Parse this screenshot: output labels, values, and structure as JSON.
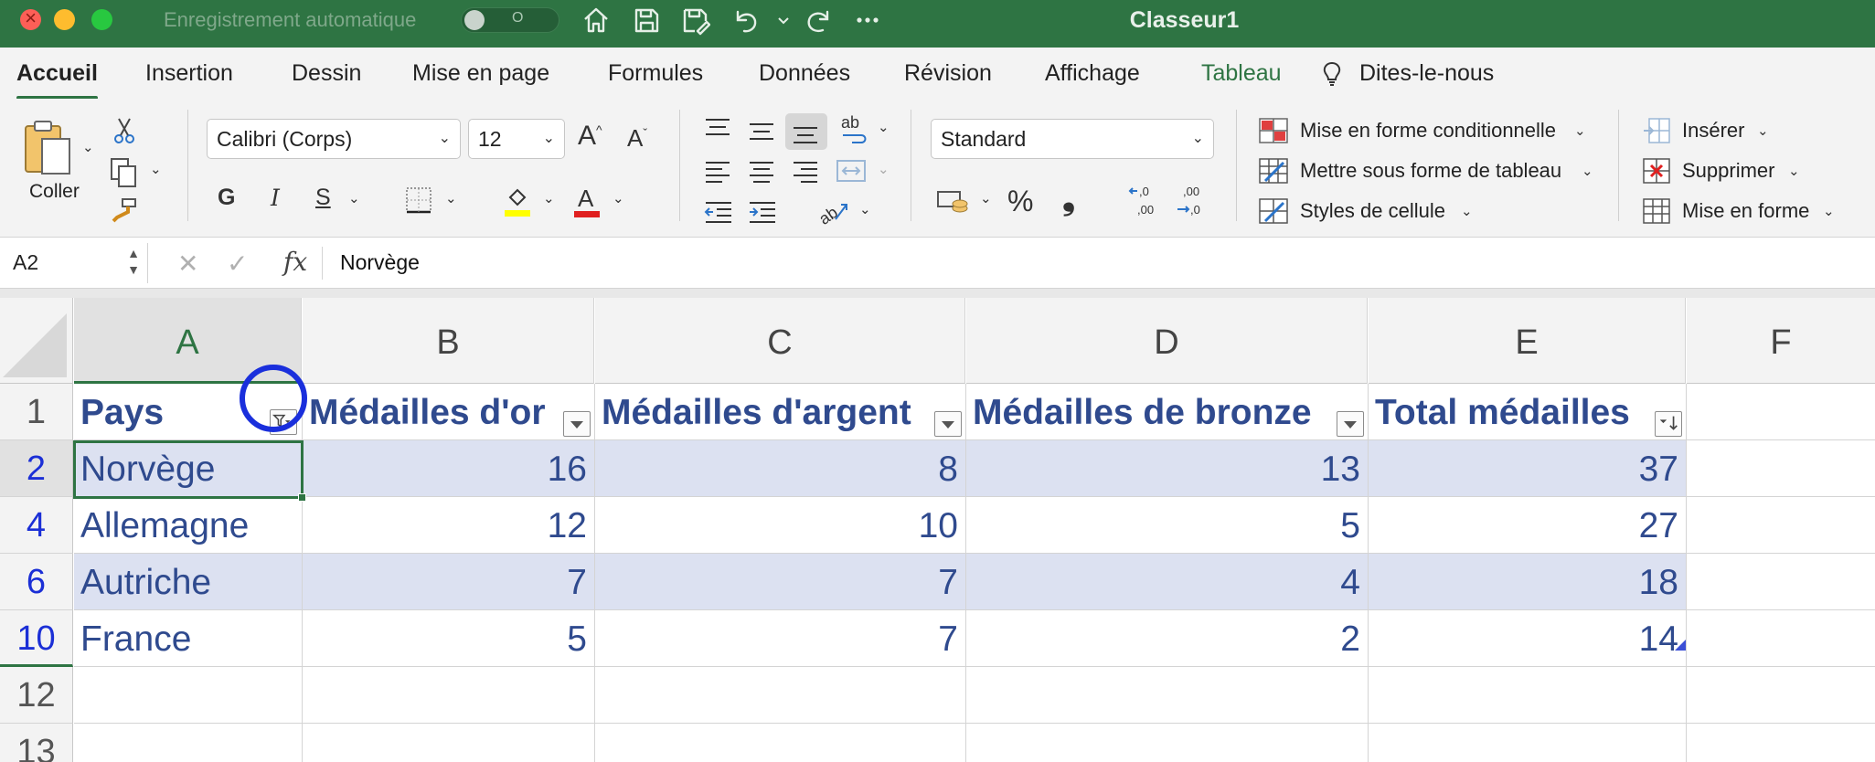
{
  "window": {
    "autosave_label": "Enregistrement automatique",
    "autosave_state": "O",
    "title": "Classeur1"
  },
  "tabs": [
    {
      "label": "Accueil"
    },
    {
      "label": "Insertion"
    },
    {
      "label": "Dessin"
    },
    {
      "label": "Mise en page"
    },
    {
      "label": "Formules"
    },
    {
      "label": "Données"
    },
    {
      "label": "Révision"
    },
    {
      "label": "Affichage"
    },
    {
      "label": "Tableau"
    },
    {
      "label": "Dites-le-nous"
    }
  ],
  "ribbon": {
    "paste_label": "Coller",
    "font_name": "Calibri (Corps)",
    "font_size": "12",
    "bold": "G",
    "italic": "I",
    "underline": "S",
    "number_format": "Standard",
    "percent": "%",
    "comma": "❟",
    "conditional_format": "Mise en forme conditionnelle",
    "format_as_table": "Mettre sous forme de tableau",
    "cell_styles": "Styles de cellule",
    "insert": "Insérer",
    "delete": "Supprimer",
    "format": "Mise en forme",
    "colors": {
      "highlight": "#ffff00",
      "font": "#e02020"
    }
  },
  "formula_bar": {
    "name_box": "A2",
    "fx": "fx",
    "value": "Norvège"
  },
  "sheet": {
    "columns": [
      "A",
      "B",
      "C",
      "D",
      "E",
      "F"
    ],
    "header_row_number": "1",
    "headers": [
      "Pays",
      "Médailles d'or",
      "Médailles d'argent",
      "Médailles de bronze",
      "Total médailles"
    ],
    "rows": [
      {
        "row": "2",
        "cells": [
          "Norvège",
          "16",
          "8",
          "13",
          "37"
        ]
      },
      {
        "row": "4",
        "cells": [
          "Allemagne",
          "12",
          "10",
          "5",
          "27"
        ]
      },
      {
        "row": "6",
        "cells": [
          "Autriche",
          "7",
          "7",
          "4",
          "18"
        ]
      },
      {
        "row": "10",
        "cells": [
          "France",
          "5",
          "7",
          "2",
          "14"
        ]
      }
    ],
    "empty_rows": [
      "12",
      "13"
    ],
    "table_colors": {
      "band": "#dce1f1",
      "text": "#2f4a8e",
      "filtered_row_number": "#1b2fd6"
    }
  }
}
